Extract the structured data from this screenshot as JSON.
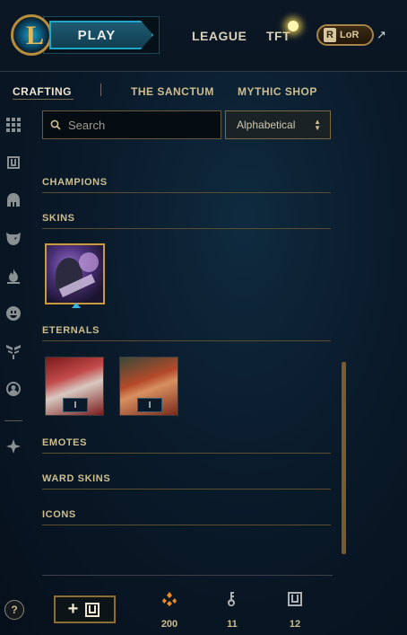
{
  "header": {
    "play_label": "PLAY",
    "nav": {
      "league": "LEAGUE",
      "tft": "TFT"
    },
    "lor_label": "LoR",
    "lor_icon_letter": "R"
  },
  "subnav": {
    "crafting": "CRAFTING",
    "sanctum": "THE SANCTUM",
    "mythic_shop": "MYTHIC SHOP"
  },
  "search": {
    "placeholder": "Search",
    "value": ""
  },
  "sort": {
    "selected": "Alphabetical"
  },
  "sections": {
    "champions": "CHAMPIONS",
    "skins": "SKINS",
    "eternals": "ETERNALS",
    "emotes": "EMOTES",
    "ward_skins": "WARD SKINS",
    "icons": "ICONS"
  },
  "eternals": [
    {
      "tier": "I"
    },
    {
      "tier": "I"
    }
  ],
  "footer": {
    "help_label": "?",
    "add_label": "+",
    "currencies": [
      {
        "icon": "orange-essence-icon",
        "value": "200"
      },
      {
        "icon": "key-icon",
        "value": "11"
      },
      {
        "icon": "chest-icon",
        "value": "12"
      }
    ]
  },
  "colors": {
    "gold": "#cdbe91",
    "accent_blue": "#1fa6c8",
    "orange_essence": "#f08a24"
  }
}
